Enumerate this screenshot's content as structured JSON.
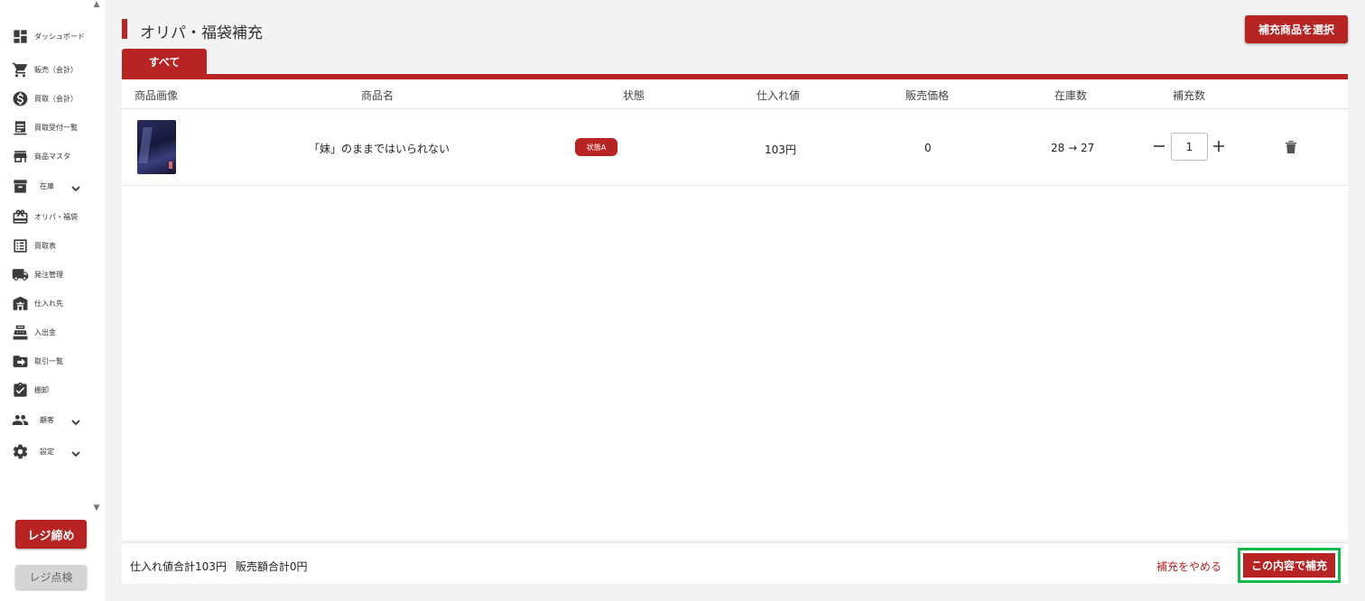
{
  "sidebar": {
    "items": [
      {
        "label": "ダッシュボード",
        "icon": "dashboard-icon"
      },
      {
        "label": "販売（会計）",
        "icon": "cart-icon"
      },
      {
        "label": "買取（会計）",
        "icon": "dollar-icon"
      },
      {
        "label": "買取受付一覧",
        "icon": "receipt-icon"
      },
      {
        "label": "商品マスタ",
        "icon": "store-icon"
      },
      {
        "label": "在庫",
        "icon": "archive-icon"
      },
      {
        "label": "オリパ・福袋",
        "icon": "gift-icon"
      },
      {
        "label": "買取表",
        "icon": "list-icon"
      },
      {
        "label": "発注管理",
        "icon": "truck-icon"
      },
      {
        "label": "仕入れ先",
        "icon": "warehouse-icon"
      },
      {
        "label": "入出金",
        "icon": "cash-register-icon"
      },
      {
        "label": "取引一覧",
        "icon": "transfer-icon"
      },
      {
        "label": "棚卸",
        "icon": "clipboard-check-icon"
      },
      {
        "label": "顧客",
        "icon": "people-icon"
      },
      {
        "label": "設定",
        "icon": "gear-icon"
      }
    ],
    "close_register_label": "レジ締め",
    "check_register_label": "レジ点検"
  },
  "header": {
    "title": "オリパ・福袋補充",
    "select_button_label": "補充商品を選択"
  },
  "tabs": [
    {
      "label": "すべて",
      "active": true
    }
  ],
  "table": {
    "columns": [
      "商品画像",
      "商品名",
      "状態",
      "仕入れ値",
      "販売価格",
      "在庫数",
      "補充数"
    ],
    "rows": [
      {
        "name": "「妹」のままではいられない",
        "condition": "状態A",
        "cost": "103円",
        "price": "0",
        "stock": "28 → 27",
        "quantity": "1"
      }
    ]
  },
  "footer": {
    "cost_total": "仕入れ値合計103円",
    "sales_total": "販売額合計0円",
    "cancel_label": "補充をやめる",
    "confirm_label": "この内容で補充"
  },
  "colors": {
    "accent": "#b82323",
    "highlight_border": "#15b84a"
  }
}
